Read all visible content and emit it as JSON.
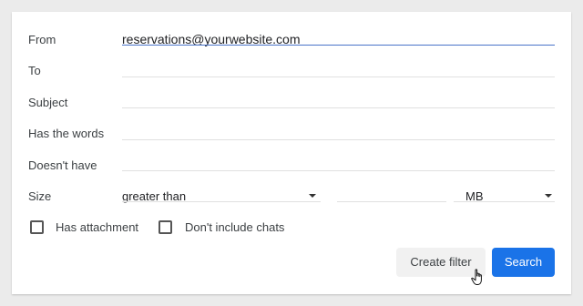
{
  "fields": {
    "from": {
      "label": "From",
      "value": "reservations@yourwebsite.com"
    },
    "to": {
      "label": "To",
      "value": ""
    },
    "subject": {
      "label": "Subject",
      "value": ""
    },
    "has_words": {
      "label": "Has the words",
      "value": ""
    },
    "doesnt_have": {
      "label": "Doesn't have",
      "value": ""
    }
  },
  "size": {
    "label": "Size",
    "operator": "greater than",
    "value": "",
    "unit": "MB"
  },
  "checkboxes": {
    "has_attachment": {
      "label": "Has attachment",
      "checked": false
    },
    "dont_include_chats": {
      "label": "Don't include chats",
      "checked": false
    }
  },
  "buttons": {
    "create_filter": "Create filter",
    "search": "Search"
  },
  "colors": {
    "accent": "#1a73e8",
    "active_underline": "#4a73c9"
  },
  "icons": [
    "chevron-down-icon",
    "hand-pointer-icon"
  ]
}
